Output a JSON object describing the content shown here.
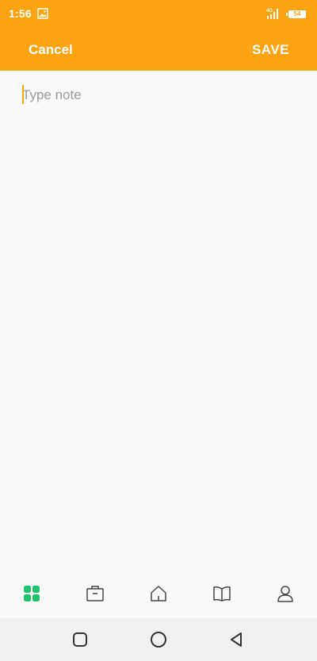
{
  "status": {
    "time": "1:56",
    "battery": "54",
    "network": "4G"
  },
  "toolbar": {
    "cancel_label": "Cancel",
    "save_label": "SAVE"
  },
  "note": {
    "placeholder": "Type note",
    "value": ""
  },
  "colors": {
    "accent": "#fca311",
    "active_nav": "#1ec26a"
  },
  "bottom_nav": {
    "items": [
      "grid-icon",
      "briefcase-icon",
      "home-icon",
      "book-icon",
      "person-icon"
    ],
    "active": "grid-icon"
  },
  "system_nav": [
    "square-icon",
    "circle-icon",
    "back-triangle-icon"
  ]
}
